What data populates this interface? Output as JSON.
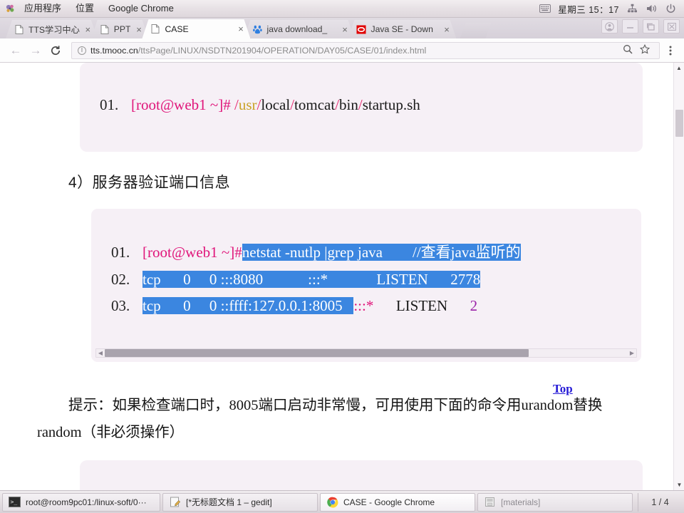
{
  "desktop": {
    "panel": {
      "logo_icon": "gnome-footprint-icon",
      "menus": [
        "应用程序",
        "位置",
        "Google Chrome"
      ],
      "keyboard_icon": "keyboard-icon",
      "clock": "星期三 15：17",
      "network_icon": "network-icon",
      "volume_icon": "volume-icon",
      "power_icon": "power-icon"
    },
    "taskbar": {
      "items": [
        {
          "icon": "terminal-icon",
          "label": "root@room9pc01:/linux-soft/0···",
          "active": false
        },
        {
          "icon": "gedit-icon",
          "label": "[*无标题文档 1 – gedit]",
          "active": false
        },
        {
          "icon": "chrome-icon",
          "label": "CASE - Google Chrome",
          "active": true
        },
        {
          "icon": "file-manager-icon",
          "label": "[materials]",
          "active": false
        }
      ],
      "workspace": "1 / 4"
    }
  },
  "browser": {
    "tabs": [
      {
        "favicon": "page-icon",
        "title": "TTS学习中心",
        "close": "×",
        "active": false
      },
      {
        "favicon": "page-icon",
        "title": "PPT",
        "close": "×",
        "active": false
      },
      {
        "favicon": "page-icon",
        "title": "CASE",
        "close": "×",
        "active": true
      },
      {
        "favicon": "baidu-icon",
        "title": "java download_",
        "close": "×",
        "active": false
      },
      {
        "favicon": "oracle-icon",
        "title": "Java SE - Down",
        "close": "×",
        "active": false
      }
    ],
    "window_controls": {
      "profile_icon": "user-avatar-icon",
      "minimize_icon": "minimize-icon",
      "maximize_icon": "maximize-icon",
      "close_icon": "close-icon"
    },
    "toolbar": {
      "back_icon": "arrow-left-icon",
      "forward_icon": "arrow-right-icon",
      "reload_icon": "reload-icon",
      "info_icon": "info-icon",
      "url_host": "tts.tmooc.cn",
      "url_path": "/ttsPage/LINUX/NSDTN201904/OPERATION/DAY05/CASE/01/index.html",
      "zoom_icon": "zoom-icon",
      "bookmark_icon": "star-icon",
      "menu_icon": "three-dots-menu-icon"
    }
  },
  "page": {
    "code_block_1": {
      "lines": [
        {
          "no": "01.",
          "segments": [
            {
              "text": "[root@web1 ~]#",
              "style": "prompt"
            },
            {
              "text": " ",
              "style": "plain"
            },
            {
              "text": "/",
              "style": "slash"
            },
            {
              "text": "usr",
              "style": "usr"
            },
            {
              "text": "/",
              "style": "slash"
            },
            {
              "text": "local",
              "style": "plain"
            },
            {
              "text": "/",
              "style": "slash"
            },
            {
              "text": "tomcat",
              "style": "plain"
            },
            {
              "text": "/",
              "style": "slash"
            },
            {
              "text": "bin",
              "style": "plain"
            },
            {
              "text": "/",
              "style": "slash"
            },
            {
              "text": "startup.sh",
              "style": "plain"
            }
          ]
        }
      ]
    },
    "section_title": "4）服务器验证端口信息",
    "code_block_2": {
      "lines": [
        {
          "no": "01.",
          "segments": [
            {
              "text": "[root@web1 ~]#",
              "style": "prompt"
            },
            {
              "text": "netstat -nutlp |grep java        //查看java监听的",
              "style": "selected"
            }
          ]
        },
        {
          "no": "02.",
          "segments": [
            {
              "text": "tcp      0     0 :::8080            :::*             LISTEN      2778",
              "style": "selected"
            }
          ]
        },
        {
          "no": "03.",
          "segments": [
            {
              "text": "tcp      0     0 ::ffff:127.0.0.1:8005   ",
              "style": "selected"
            },
            {
              "text": ":::*",
              "style": "pink"
            },
            {
              "text": "      LISTEN      ",
              "style": "plain"
            },
            {
              "text": "2",
              "style": "purple"
            }
          ]
        }
      ],
      "hscrollbar": {
        "left_arrow": "◀",
        "right_arrow": "▶"
      }
    },
    "paragraph": {
      "indent": "",
      "line1": "提示：如果检查端口时，8005端口启动非常慢，可用使用下面的命令用",
      "line2": "urandom替换random（非必须操作）"
    },
    "top_link": "Top",
    "cursor_icon": "mouse-pointer-icon",
    "vertical_scrollbar": {
      "up_arrow": "▲",
      "down_arrow": "▼"
    }
  },
  "colors": {
    "selection_blue": "#3b86e0",
    "prompt_pink": "#e0157a",
    "slash_pink": "#e8266e",
    "usr_yellow": "#c9a227",
    "purple": "#9b23a8",
    "link_blue": "#2419d6",
    "code_bg": "#f6f0f6"
  }
}
